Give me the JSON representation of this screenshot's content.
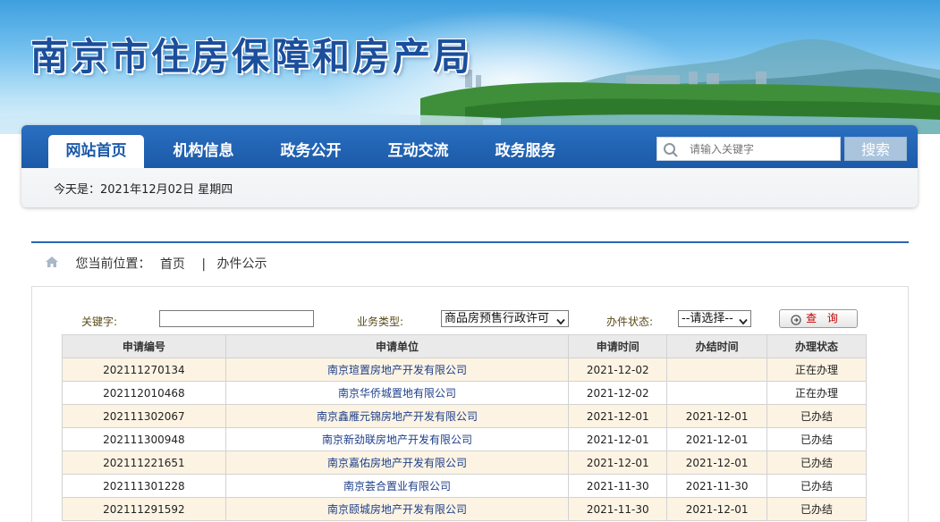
{
  "header": {
    "title": "南京市住房保障和房产局"
  },
  "nav": {
    "items": [
      {
        "label": "网站首页",
        "active": true
      },
      {
        "label": "机构信息",
        "active": false
      },
      {
        "label": "政务公开",
        "active": false
      },
      {
        "label": "互动交流",
        "active": false
      },
      {
        "label": "政务服务",
        "active": false
      }
    ],
    "search": {
      "placeholder": "请输入关键字",
      "button_label": "搜索",
      "icon": "search-icon"
    }
  },
  "date_line": "今天是：2021年12月02日 星期四",
  "breadcrumb": {
    "icon": "home-icon",
    "prefix": "您当前位置：",
    "home": "首页",
    "separator": "|",
    "current": "办件公示"
  },
  "filters": {
    "keyword_label": "关键字:",
    "keyword_value": "",
    "type_label": "业务类型:",
    "type_value": "商品房预售行政许可",
    "status_label": "办件状态:",
    "status_value": "--请选择--",
    "query_label": "查 询"
  },
  "table": {
    "headers": [
      "申请编号",
      "申请单位",
      "申请时间",
      "办结时间",
      "办理状态"
    ],
    "rows": [
      [
        "202111270134",
        "南京瑄置房地产开发有限公司",
        "2021-12-02",
        "",
        "正在办理"
      ],
      [
        "202112010468",
        "南京华侨城置地有限公司",
        "2021-12-02",
        "",
        "正在办理"
      ],
      [
        "202111302067",
        "南京鑫雁元锦房地产开发有限公司",
        "2021-12-01",
        "2021-12-01",
        "已办结"
      ],
      [
        "202111300948",
        "南京新劲联房地产开发有限公司",
        "2021-12-01",
        "2021-12-01",
        "已办结"
      ],
      [
        "202111221651",
        "南京嘉佑房地产开发有限公司",
        "2021-12-01",
        "2021-12-01",
        "已办结"
      ],
      [
        "202111301228",
        "南京荟合置业有限公司",
        "2021-11-30",
        "2021-11-30",
        "已办结"
      ],
      [
        "202111291592",
        "南京颐城房地产开发有限公司",
        "2021-11-30",
        "2021-12-01",
        "已办结"
      ]
    ]
  },
  "colors": {
    "brand_blue": "#1b5aa8",
    "row_highlight": "#fcf3e3",
    "query_text": "#c00000"
  }
}
